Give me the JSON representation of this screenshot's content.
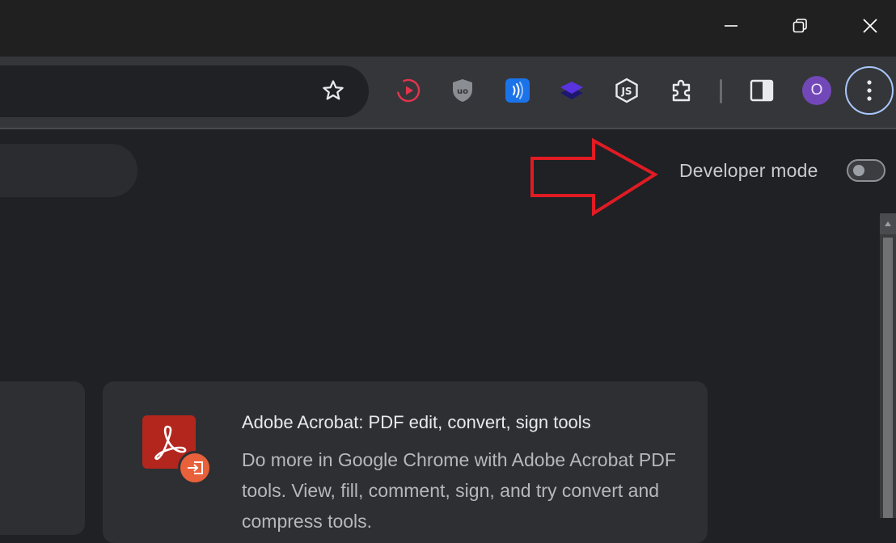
{
  "browser": {
    "window_controls": {
      "minimize": "minimize-icon",
      "restore": "restore-icon",
      "close": "close-icon"
    },
    "toolbar": {
      "bookmark_icon": "star-icon",
      "extensions": [
        {
          "name": "media-extension-icon",
          "color": "#e3344d"
        },
        {
          "name": "ublock-origin-icon",
          "label": "uo"
        },
        {
          "name": "text-to-speech-icon",
          "color": "#1a73e8"
        },
        {
          "name": "layers-extension-icon",
          "color": "#4d2bd6"
        },
        {
          "name": "js-extension-icon",
          "label": "JS"
        },
        {
          "name": "extensions-puzzle-icon"
        }
      ],
      "side_panel_icon": "side-panel-icon",
      "profile": {
        "initial": "O",
        "color": "#7248b9"
      },
      "menu_icon": "three-dot-menu-icon"
    }
  },
  "page": {
    "developer_mode": {
      "label": "Developer mode",
      "enabled": false
    },
    "annotation": {
      "type": "red-arrow",
      "color": "#e01b24"
    },
    "extension_card": {
      "name": "Adobe Acrobat: PDF edit, convert, sign tools",
      "description": "Do more in Google Chrome with Adobe Acrobat PDF tools. View, fill, comment, sign, and try convert and compress tools.",
      "icon": "adobe-acrobat-icon",
      "badge_icon": "import-badge-icon",
      "icon_color": "#b3261e",
      "badge_color": "#e8613a"
    }
  }
}
